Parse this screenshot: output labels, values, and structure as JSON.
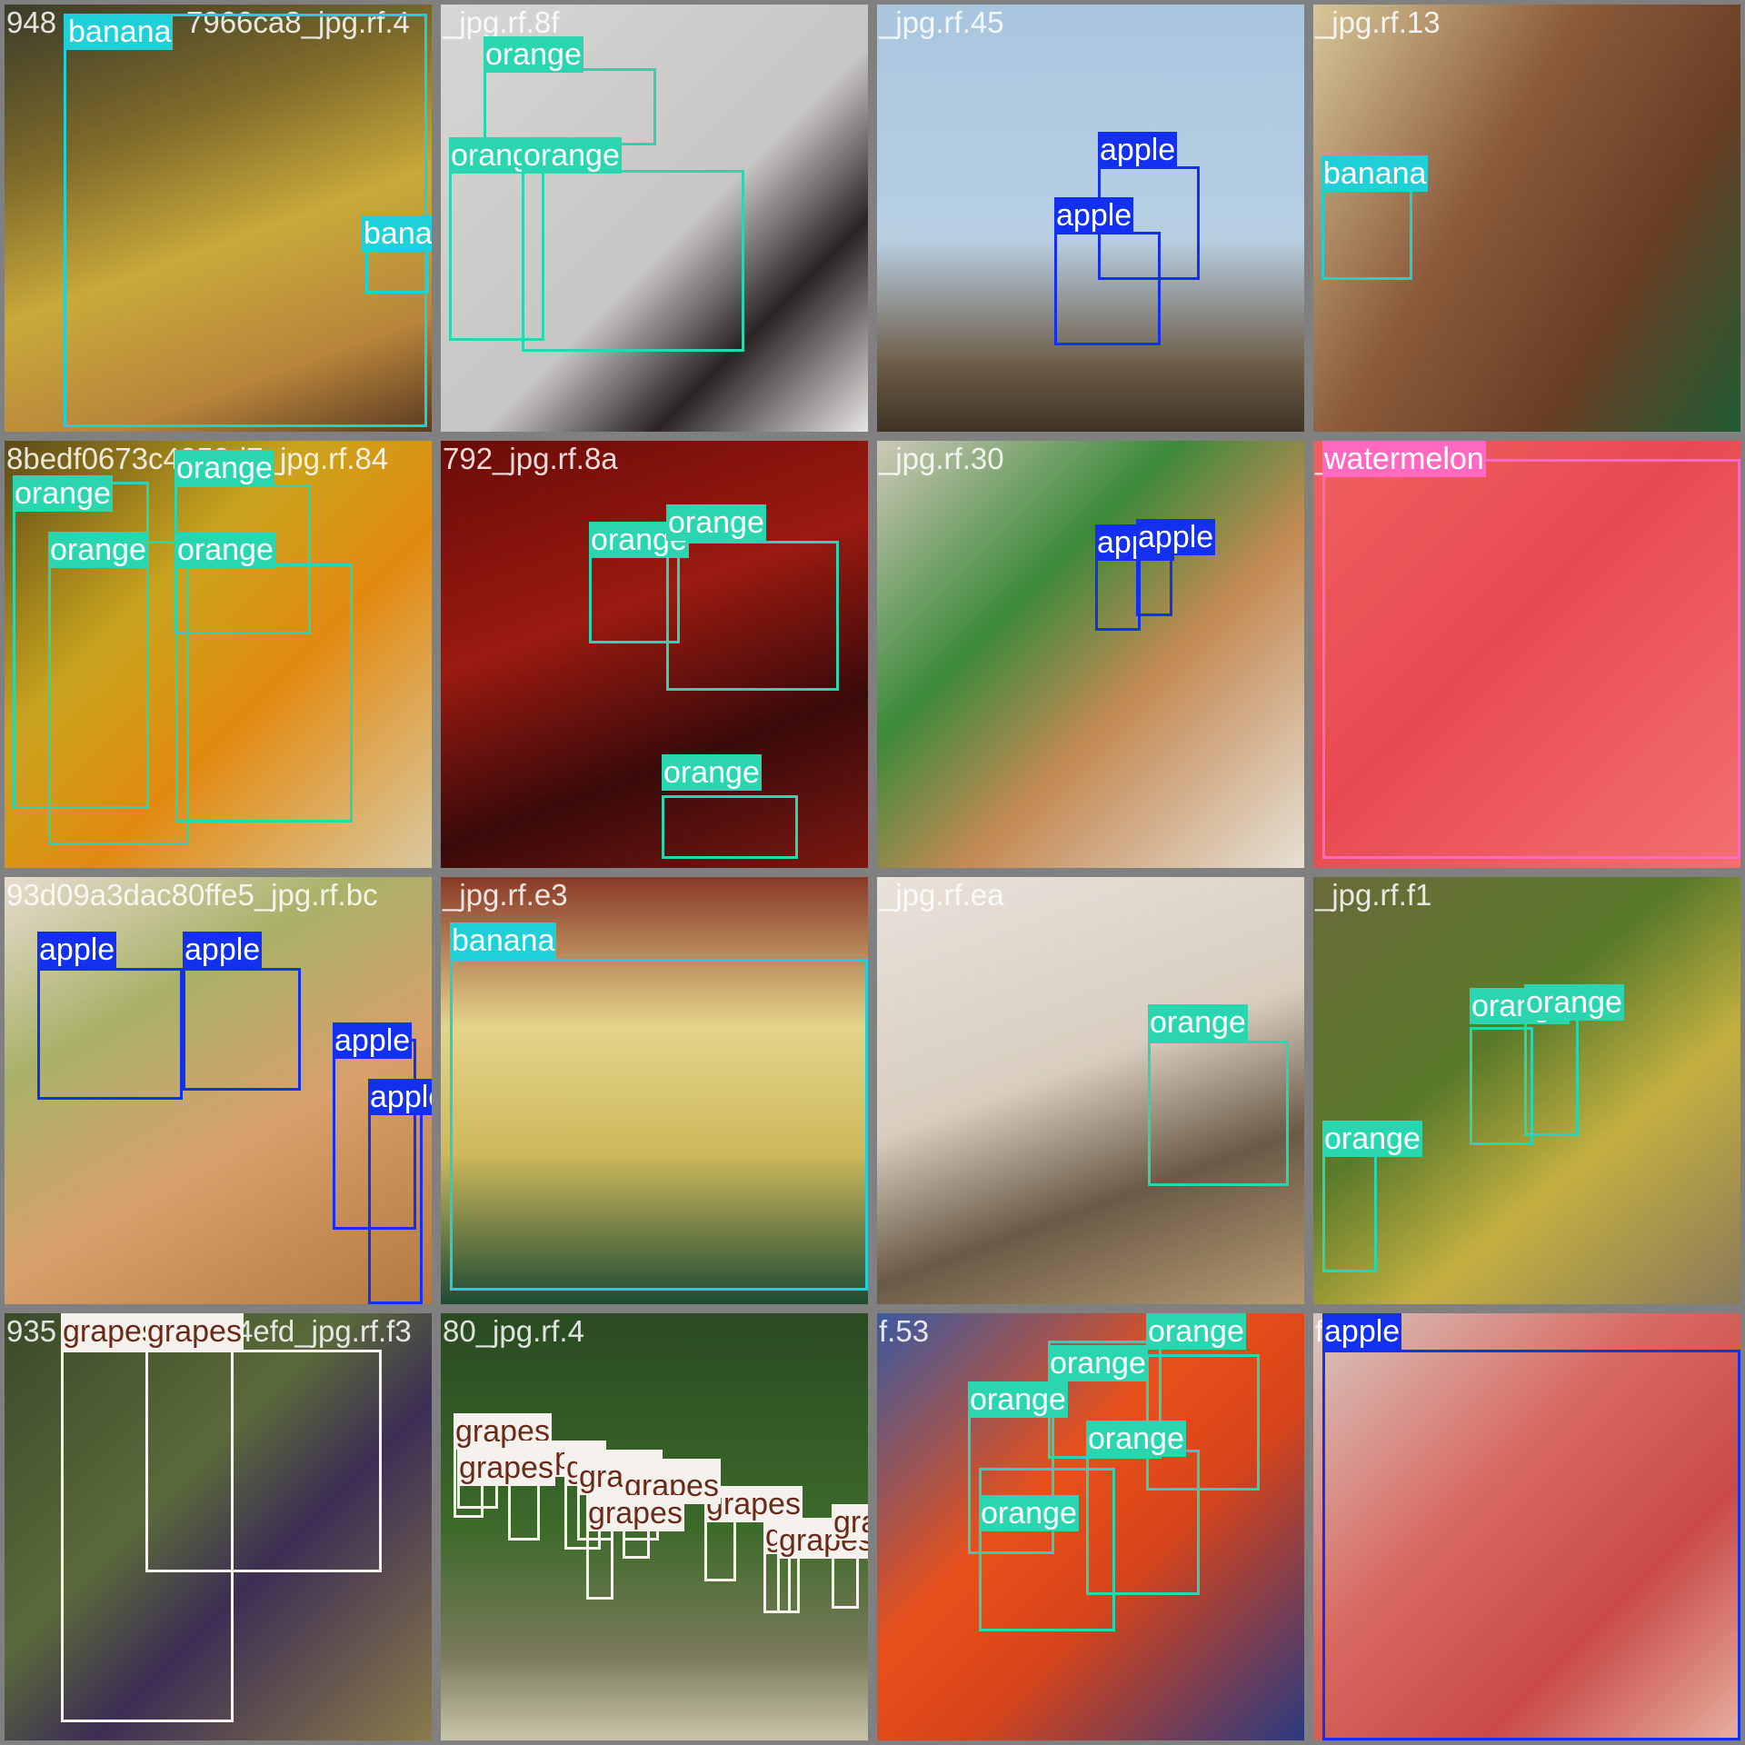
{
  "class_colors": {
    "banana": {
      "box": "#1fd0d8",
      "label_bg": "#1fd0d8",
      "label_fg": "#ffffff"
    },
    "orange": {
      "box": "#2ad6b0",
      "label_bg": "#2ad6b0",
      "label_fg": "#ffffff"
    },
    "apple": {
      "box": "#1230ee",
      "label_bg": "#1230ee",
      "label_fg": "#ffffff"
    },
    "watermelon": {
      "box": "#ff69c0",
      "label_bg": "#ff69c0",
      "label_fg": "#ffffff"
    },
    "grapes": {
      "box": "#f5f2ee",
      "label_bg": "#f5f2ee",
      "label_fg": "#6a2a1a"
    }
  },
  "tiles": [
    {
      "filename": "948",
      "labels": [
        "banana",
        "banana"
      ]
    },
    {
      "filename": "7966ca8_jpg.rf.4",
      "labels": []
    },
    {
      "filename": "_jpg.rf.8f",
      "labels": [
        "orange",
        "orange",
        "orange"
      ]
    },
    {
      "filename": "_jpg.rf.45",
      "labels": [
        "apple",
        "apple"
      ]
    },
    {
      "filename": "_jpg.rf.13",
      "labels": [
        "banana"
      ]
    },
    {
      "filename": "8bedf0673c4850d7_jpg.rf.84",
      "labels": [
        "orange",
        "orange",
        "orange",
        "orange"
      ]
    },
    {
      "filename": "792_jpg.rf.8a",
      "labels": [
        "orange",
        "orange",
        "orange"
      ]
    },
    {
      "filename": "_jpg.rf.30",
      "labels": [
        "apple",
        "apple"
      ]
    },
    {
      "filename": "_jpg.rf.3c",
      "labels": [
        "watermelon"
      ]
    },
    {
      "filename": "93d09a3dac80ffe5_jpg.rf.bc",
      "labels": [
        "apple",
        "apple",
        "apple",
        "apple"
      ]
    },
    {
      "filename": "_jpg.rf.e3",
      "labels": [
        "banana"
      ]
    },
    {
      "filename": "_jpg.rf.ea",
      "labels": [
        "orange"
      ]
    },
    {
      "filename": "_jpg.rf.f1",
      "labels": [
        "orange",
        "orange",
        "orange"
      ]
    },
    {
      "filename": "935",
      "labels": [
        "grapes",
        "grapes"
      ]
    },
    {
      "filename": "9794efd_jpg.rf.f3",
      "labels": []
    },
    {
      "filename": "80_jpg.rf.4",
      "labels": [
        "grapes",
        "grapes",
        "grapes",
        "grapes",
        "grapes",
        "grapes",
        "grapes",
        "grapes",
        "grapes",
        "grapes",
        "grapes",
        "grapes"
      ]
    },
    {
      "filename": "f.53",
      "labels": [
        "orange",
        "orange",
        "orange",
        "orange",
        "orange"
      ]
    },
    {
      "filename": "f.09",
      "labels": [
        "apple"
      ]
    }
  ],
  "grid": [
    {
      "filename": "948",
      "filename_extra": "7966ca8_jpg.rf.4",
      "background": "linear-gradient(160deg,#3b3c2a 0%,#7e6a2a 30%,#c9a93a 55%,#b8853a 80%,#5a3a22 100%)",
      "detections": [
        {
          "label": "banana"
        },
        {
          "label": "banana"
        }
      ]
    },
    {
      "filename": "_jpg.rf.8f",
      "background": "linear-gradient(135deg,#d8d6d4 0%,#c8c6c4 55%,#2a2424 75%,#e8e6e4 100%)",
      "detections": [
        {
          "label": "orange"
        },
        {
          "label": "orange"
        },
        {
          "label": "orange"
        }
      ]
    },
    {
      "filename": "_jpg.rf.45",
      "background": "linear-gradient(180deg,#a9c6df 0%,#b8cfe2 55%,#6b5a44 85%,#3e3426 100%)",
      "detections": [
        {
          "label": "apple"
        },
        {
          "label": "apple"
        }
      ]
    },
    {
      "filename": "_jpg.rf.13",
      "background": "linear-gradient(120deg,#d7c79a 0%,#8b5a3a 40%,#6a3e26 70%,#1f5a30 100%)",
      "detections": [
        {
          "label": "banana"
        }
      ]
    },
    {
      "filename": "8bedf0673c4850d7_jpg.rf.84",
      "background": "linear-gradient(135deg,#5a4a18 0%,#c9a41e 35%,#e28a10 60%,#d9c8a0 100%)",
      "detections": [
        {
          "label": "orange"
        },
        {
          "label": "orange"
        },
        {
          "label": "orange"
        },
        {
          "label": "orange"
        }
      ]
    },
    {
      "filename": "792_jpg.rf.8a",
      "background": "linear-gradient(160deg,#6a0c08 0%,#9a1a10 40%,#3a0a0a 70%,#7a1810 100%)",
      "detections": [
        {
          "label": "orange"
        },
        {
          "label": "orange"
        },
        {
          "label": "orange"
        }
      ]
    },
    {
      "filename": "_jpg.rf.30",
      "background": "linear-gradient(135deg,#cfc8b8 0%,#3c8a3a 35%,#c48a54 60%,#e6e0d4 100%)",
      "detections": [
        {
          "label": "apple"
        },
        {
          "label": "apple"
        }
      ]
    },
    {
      "filename": "_jpg.rf.3c",
      "background": "linear-gradient(135deg,#f06060 0%,#e84a52 45%,#f37070 100%)",
      "detections": [
        {
          "label": "watermelon"
        }
      ]
    },
    {
      "filename": "93d09a3dac80ffe5_jpg.rf.bc",
      "background": "linear-gradient(150deg,#e8dcd0 0%,#a9b26a 30%,#d8a06a 60%,#b07a40 100%)",
      "detections": [
        {
          "label": "apple"
        },
        {
          "label": "apple"
        },
        {
          "label": "apple"
        },
        {
          "label": "apple"
        }
      ]
    },
    {
      "filename": "_jpg.rf.e3",
      "background": "linear-gradient(180deg,#8a3a28 0%,#e4d48a 35%,#cdb85a 65%,#1e4a32 100%)",
      "detections": [
        {
          "label": "banana"
        }
      ]
    },
    {
      "filename": "_jpg.rf.ea",
      "background": "linear-gradient(160deg,#e9e2da 0%,#d8cdbf 45%,#6a5a46 70%,#b59a72 100%)",
      "detections": [
        {
          "label": "orange"
        }
      ]
    },
    {
      "filename": "_jpg.rf.f1",
      "background": "linear-gradient(140deg,#6a6a3a 0%,#5a7a2a 40%,#c4b040 65%,#8a7a5a 100%)",
      "detections": [
        {
          "label": "orange"
        },
        {
          "label": "orange"
        },
        {
          "label": "orange"
        }
      ]
    },
    {
      "filename": "935",
      "filename_extra": "9794efd_jpg.rf.f3",
      "background": "linear-gradient(135deg,#3a4a2a 0%,#5a6a3a 40%,#3c2e54 60%,#8a7a4a 100%)",
      "detections": [
        {
          "label": "grapes"
        },
        {
          "label": "grapes"
        }
      ]
    },
    {
      "filename": "80_jpg.rf.4",
      "background": "linear-gradient(180deg,#2a4a22 0%,#3c6a2a 50%,#7a7a5a 80%,#c8c4a8 100%)",
      "detections": [
        {
          "label": "grapes"
        },
        {
          "label": "grapes"
        },
        {
          "label": "grapes"
        },
        {
          "label": "grapes"
        },
        {
          "label": "grapes"
        },
        {
          "label": "grapes"
        },
        {
          "label": "grapes"
        },
        {
          "label": "grapes"
        },
        {
          "label": "grapes"
        },
        {
          "label": "grapes"
        },
        {
          "label": "grapes"
        },
        {
          "label": "grapes"
        }
      ]
    },
    {
      "filename": "f.53",
      "background": "linear-gradient(135deg,#3a5aa0 0%,#e8501a 40%,#d8441a 60%,#2a3a80 100%)",
      "detections": [
        {
          "label": "orange"
        },
        {
          "label": "orange"
        },
        {
          "label": "orange"
        },
        {
          "label": "orange"
        },
        {
          "label": "orange"
        }
      ]
    },
    {
      "filename": "f.09",
      "background": "linear-gradient(135deg,#d8c8c0 0%,#d86a62 40%,#c94a48 70%,#e6b0a0 100%)",
      "detections": [
        {
          "label": "apple"
        }
      ]
    }
  ]
}
